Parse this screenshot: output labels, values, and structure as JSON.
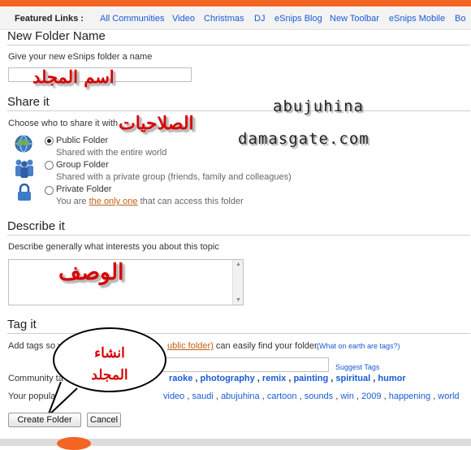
{
  "featured": {
    "label": "Featured Links :",
    "links": [
      "All Communities",
      "Video",
      "Christmas",
      "DJ",
      "eSnips Blog",
      "New Toolbar",
      "eSnips Mobile",
      "Bo"
    ]
  },
  "new_folder": {
    "title": "New Folder Name",
    "hint": "Give your new eSnips folder a name",
    "input_value": ""
  },
  "share": {
    "title": "Share it",
    "hint": "Choose who to share it with",
    "options": [
      {
        "label": "Public Folder",
        "desc": "Shared with the entire world",
        "selected": true,
        "icon": "globe-icon"
      },
      {
        "label": "Group Folder",
        "desc": "Shared with a private group (friends, family and colleagues)",
        "selected": false,
        "icon": "group-icon"
      },
      {
        "label": "Private Folder",
        "desc_prefix": "You are",
        "desc_link": "the only one",
        "desc_suffix": "that can access this folder",
        "selected": false,
        "icon": "lock-icon"
      }
    ]
  },
  "describe": {
    "title": "Describe it",
    "hint": "Describe generally what interests you about this topic",
    "value": ""
  },
  "tag": {
    "title": "Tag it",
    "hint_prefix": "Add tags so yo",
    "hint_link": "ublic folder)",
    "hint_suffix": "can easily find your folder.",
    "help_link": "(What on earth are tags?)",
    "suggest_label": "Suggest Tags",
    "input_value": "",
    "community_label": "Community ta",
    "community_tags": [
      "raoke",
      "photography",
      "remix",
      "painting",
      "spiritual",
      "humor"
    ],
    "popular_label": "Your popular t",
    "popular_tags": [
      "video",
      "saudi",
      "abujuhina",
      "cartoon",
      "sounds",
      "win",
      "2009",
      "happening",
      "world"
    ]
  },
  "buttons": {
    "create": "Create Folder",
    "cancel": "Cancel"
  },
  "overlay": {
    "folder_name_ar": "اسم المجلد",
    "permissions_ar": "الصلاحيات",
    "description_ar": "الوصف",
    "create_ar_line1": "انشاء",
    "create_ar_line2": "المجلد",
    "watermark_name": "abujuhina",
    "watermark_site": "damasgate.com"
  },
  "colors": {
    "brand_orange": "#f26522",
    "link_blue": "#1a5bd4",
    "overlay_red": "#d90000"
  }
}
